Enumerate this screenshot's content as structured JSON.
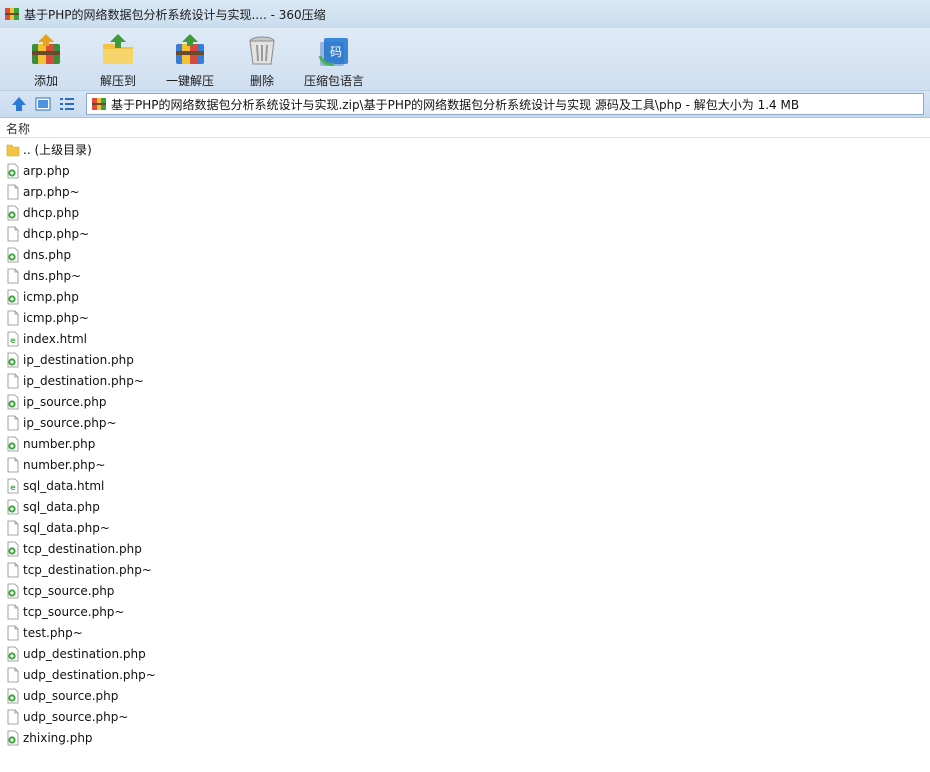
{
  "window": {
    "title": "基于PHP的网络数据包分析系统设计与实现.... - 360压缩"
  },
  "toolbar": {
    "buttons": [
      {
        "label": "添加",
        "icon": "add-archive-icon"
      },
      {
        "label": "解压到",
        "icon": "extract-to-icon"
      },
      {
        "label": "一键解压",
        "icon": "one-click-extract-icon"
      },
      {
        "label": "删除",
        "icon": "delete-trash-icon"
      },
      {
        "label": "压缩包语言",
        "icon": "archive-language-icon"
      }
    ]
  },
  "address_bar": {
    "path": "基于PHP的网络数据包分析系统设计与实现.zip\\基于PHP的网络数据包分析系统设计与实现 源码及工具\\php - 解包大小为 1.4 MB"
  },
  "file_list": {
    "column_name": "名称",
    "items": [
      {
        "name": ".. (上级目录)",
        "type": "folder"
      },
      {
        "name": "arp.php",
        "type": "php"
      },
      {
        "name": "arp.php~",
        "type": "file"
      },
      {
        "name": "dhcp.php",
        "type": "php"
      },
      {
        "name": "dhcp.php~",
        "type": "file"
      },
      {
        "name": "dns.php",
        "type": "php"
      },
      {
        "name": "dns.php~",
        "type": "file"
      },
      {
        "name": "icmp.php",
        "type": "php"
      },
      {
        "name": "icmp.php~",
        "type": "file"
      },
      {
        "name": "index.html",
        "type": "html"
      },
      {
        "name": "ip_destination.php",
        "type": "php"
      },
      {
        "name": "ip_destination.php~",
        "type": "file"
      },
      {
        "name": "ip_source.php",
        "type": "php"
      },
      {
        "name": "ip_source.php~",
        "type": "file"
      },
      {
        "name": "number.php",
        "type": "php"
      },
      {
        "name": "number.php~",
        "type": "file"
      },
      {
        "name": "sql_data.html",
        "type": "html"
      },
      {
        "name": "sql_data.php",
        "type": "php"
      },
      {
        "name": "sql_data.php~",
        "type": "file"
      },
      {
        "name": "tcp_destination.php",
        "type": "php"
      },
      {
        "name": "tcp_destination.php~",
        "type": "file"
      },
      {
        "name": "tcp_source.php",
        "type": "php"
      },
      {
        "name": "tcp_source.php~",
        "type": "file"
      },
      {
        "name": "test.php~",
        "type": "file"
      },
      {
        "name": "udp_destination.php",
        "type": "php"
      },
      {
        "name": "udp_destination.php~",
        "type": "file"
      },
      {
        "name": "udp_source.php",
        "type": "php"
      },
      {
        "name": "udp_source.php~",
        "type": "file"
      },
      {
        "name": "zhixing.php",
        "type": "php"
      }
    ]
  },
  "colors": {
    "title_bg": "#dbe9f6",
    "toolbar_bg": "#dfeaf6",
    "php_icon_green": "#3aa53a",
    "html_icon_green": "#4caf50"
  }
}
